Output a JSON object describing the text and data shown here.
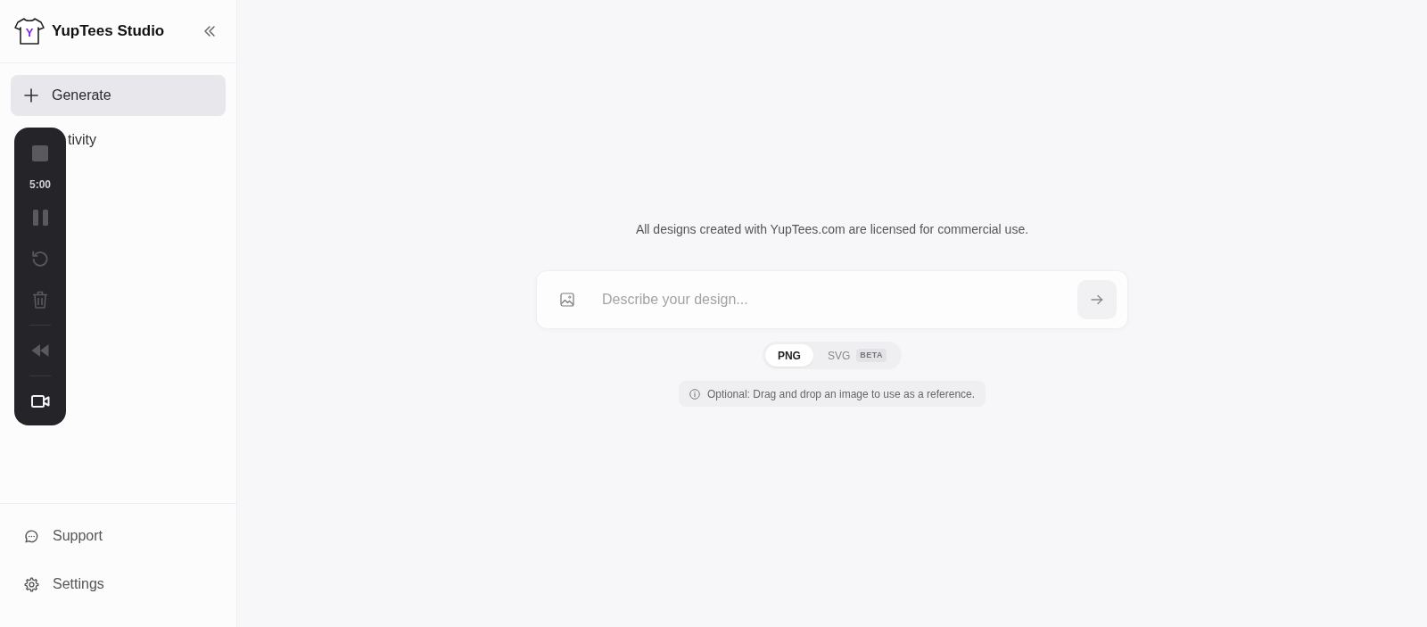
{
  "sidebar": {
    "logo_letter": "Y",
    "title": "YupTees Studio",
    "nav": [
      {
        "label": "Generate",
        "selected": true
      },
      {
        "label": "tivity",
        "selected": false
      }
    ],
    "footer": [
      {
        "label": "Support"
      },
      {
        "label": "Settings"
      }
    ]
  },
  "recorder": {
    "sections": [
      {
        "items": [
          {
            "kind": "button",
            "disabled": true
          },
          {
            "kind": "timer",
            "text": "5:00"
          },
          {
            "kind": "button",
            "disabled": true
          },
          {
            "kind": "button",
            "disabled": true
          },
          {
            "kind": "button",
            "disabled": true
          }
        ]
      },
      {
        "items": [
          {
            "kind": "button",
            "disabled": true
          }
        ]
      },
      {
        "items": [
          {
            "kind": "button",
            "disabled": false
          }
        ]
      }
    ]
  },
  "main": {
    "notice": "All designs created with YupTees.com are licensed for commercial use.",
    "prompt": {
      "placeholder": "Describe your design..."
    },
    "formats": [
      {
        "label": "PNG",
        "selected": true
      },
      {
        "label": "SVG",
        "selected": false,
        "badge": "BETA"
      }
    ],
    "hint": "Optional: Drag and drop an image to use as a reference."
  }
}
